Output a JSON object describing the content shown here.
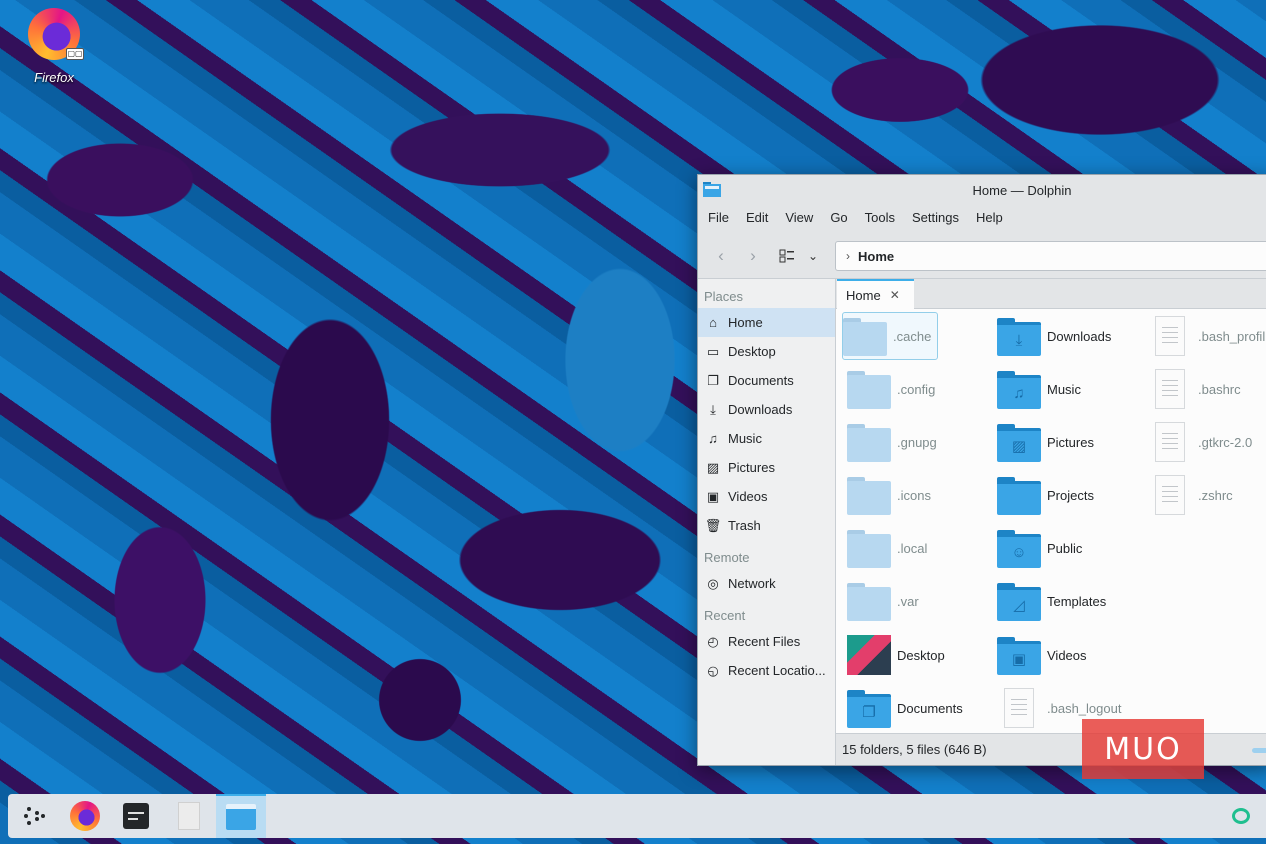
{
  "desktop": {
    "icon_label": "Firefox",
    "icon_badge": "▢▢"
  },
  "window": {
    "title": "Home — Dolphin",
    "menu": [
      "File",
      "Edit",
      "View",
      "Go",
      "Tools",
      "Settings",
      "Help"
    ],
    "breadcrumb": "Home",
    "tab_label": "Home",
    "sidebar": {
      "places_header": "Places",
      "places": [
        {
          "label": "Home",
          "icon": "home-icon",
          "active": true
        },
        {
          "label": "Desktop",
          "icon": "desktop-icon"
        },
        {
          "label": "Documents",
          "icon": "documents-icon"
        },
        {
          "label": "Downloads",
          "icon": "downloads-icon"
        },
        {
          "label": "Music",
          "icon": "music-icon"
        },
        {
          "label": "Pictures",
          "icon": "pictures-icon"
        },
        {
          "label": "Videos",
          "icon": "videos-icon"
        },
        {
          "label": "Trash",
          "icon": "trash-icon"
        }
      ],
      "remote_header": "Remote",
      "remote": [
        {
          "label": "Network",
          "icon": "network-icon"
        }
      ],
      "recent_header": "Recent",
      "recent": [
        {
          "label": "Recent Files",
          "icon": "recent-files-icon"
        },
        {
          "label": "Recent Locatio...",
          "icon": "recent-locations-icon"
        }
      ]
    },
    "files": {
      "col1": [
        ".cache",
        ".config",
        ".gnupg",
        ".icons",
        ".local",
        ".var",
        "Desktop",
        "Documents"
      ],
      "col2": [
        "Downloads",
        "Music",
        "Pictures",
        "Projects",
        "Public",
        "Templates",
        "Videos",
        ".bash_logout"
      ],
      "col3": [
        ".bash_profil",
        ".bashrc",
        ".gtkrc-2.0",
        ".zshrc"
      ]
    },
    "status": "15 folders, 5 files (646 B)"
  },
  "watermark": "MUO",
  "colors": {
    "accent": "#3daee9",
    "folder_blue": "#3aa5e6",
    "hidden_folder": "#b7d8f0",
    "watermark": "#e53935"
  }
}
